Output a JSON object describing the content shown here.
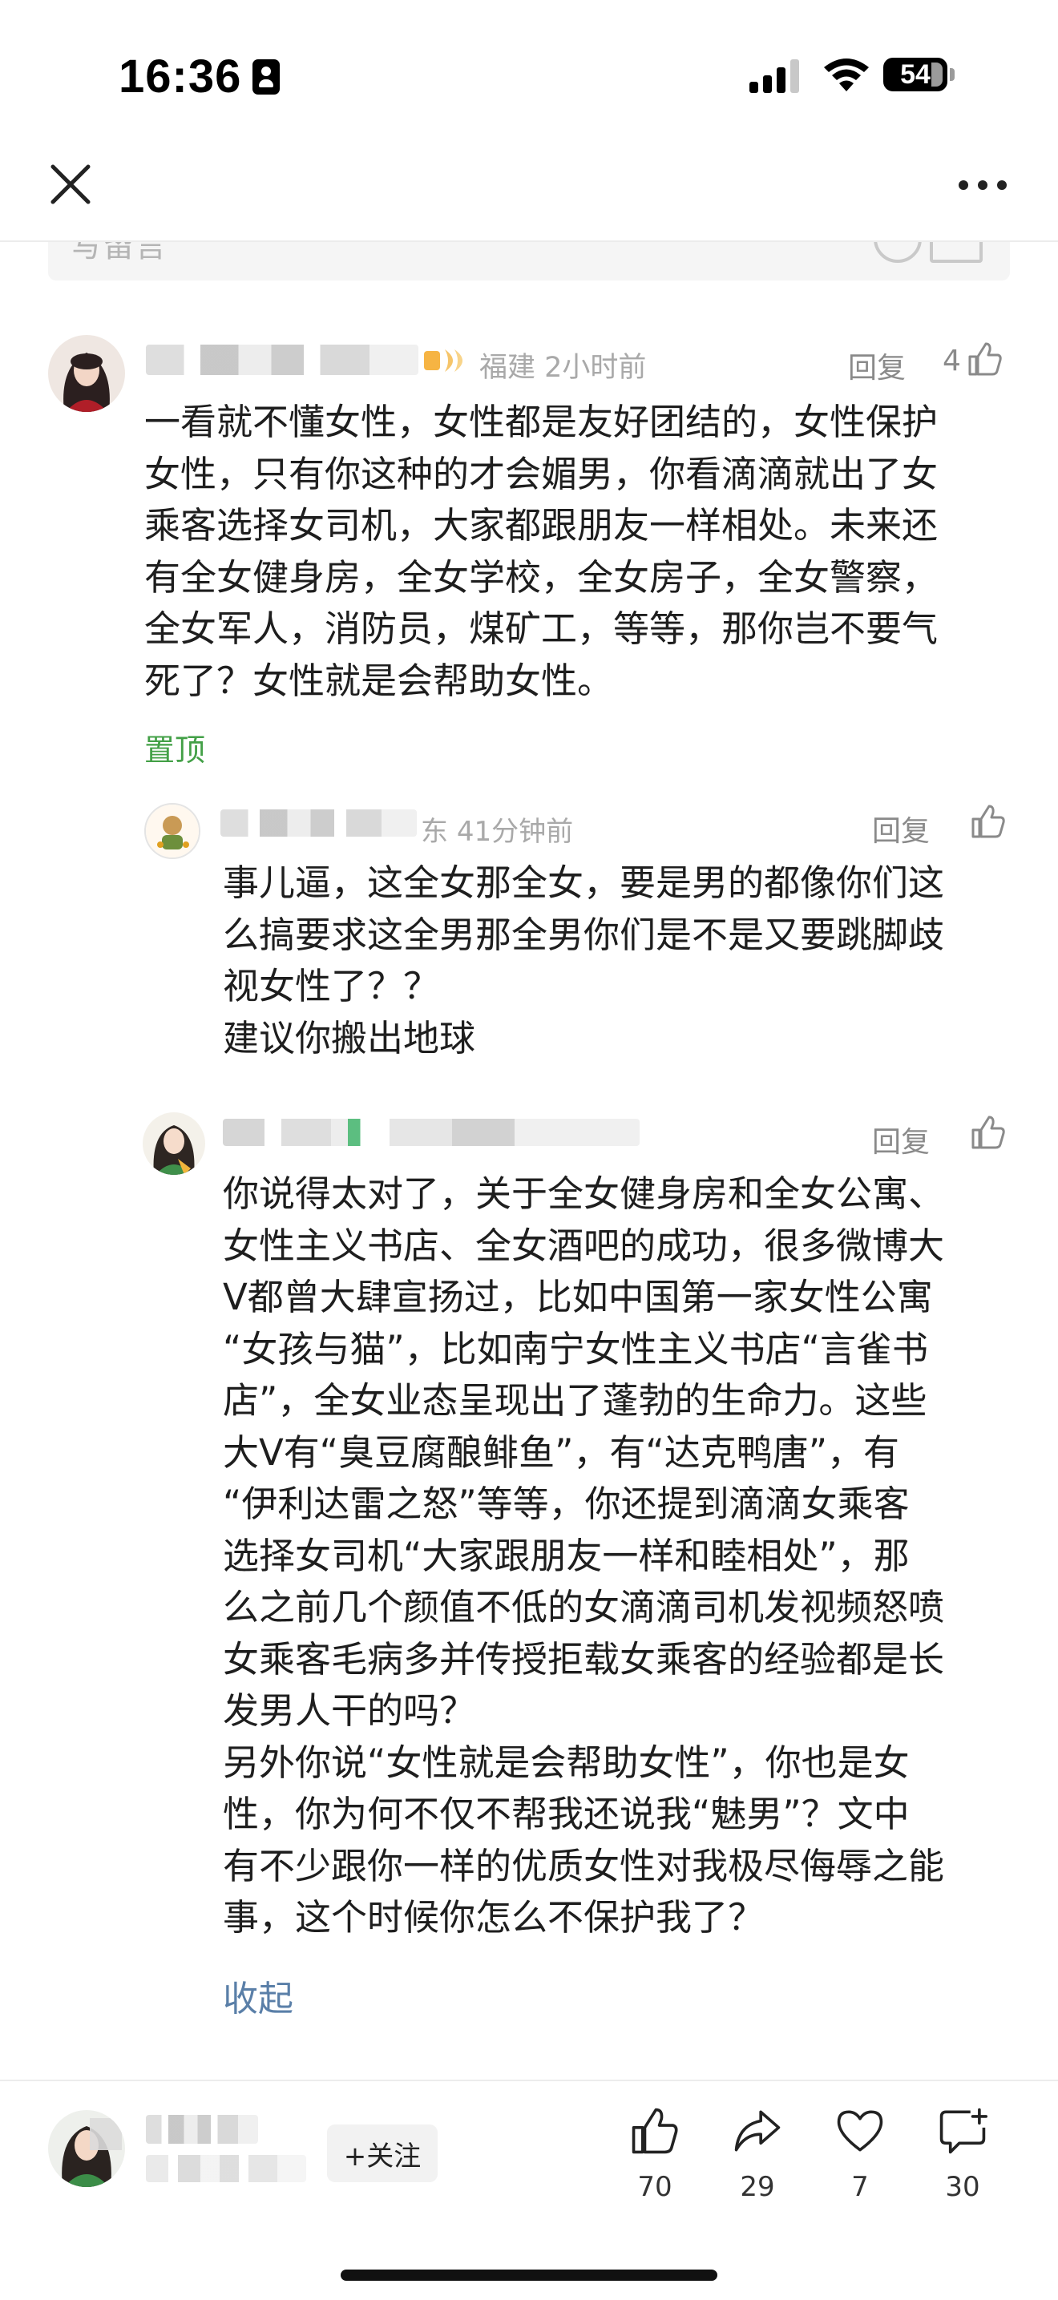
{
  "status_bar": {
    "time": "16:36",
    "battery": "54"
  },
  "input": {
    "placeholder": "写留言"
  },
  "comments": [
    {
      "location": "福建",
      "time": "2小时前",
      "reply_label": "回复",
      "likes": "4",
      "text": "一看就不懂女性，女性都是友好团结的，女性保护女性，只有你这种的才会媚男，你看滴滴就出了女乘客选择女司机，大家都跟朋友一样相处。未来还有全女健身房，全女学校，全女房子，全女警察，全女军人，消防员，煤矿工，等等，那你岂不要气死了？女性就是会帮助女性。",
      "lines": [
        "一看就不懂女性，女性都是友好团结的，女性保护",
        "女性，只有你这种的才会媚男，你看滴滴就出了女",
        "乘客选择女司机，大家都跟朋友一样相处。未来还",
        "有全女健身房，全女学校，全女房子，全女警察，",
        "全女军人，消防员，煤矿工，等等，那你岂不要气",
        "死了？女性就是会帮助女性。"
      ],
      "pin_label": "置顶"
    }
  ],
  "replies": [
    {
      "location_fragment": "东",
      "time": "41分钟前",
      "reply_label": "回复",
      "lines": [
        "事儿逼，这全女那全女，要是男的都像你们这",
        "么搞要求这全男那全男你们是不是又要跳脚歧",
        "视女性了？？",
        "建议你搬出地球"
      ]
    },
    {
      "reply_label": "回复",
      "lines": [
        "你说得太对了，关于全女健身房和全女公寓、",
        "女性主义书店、全女酒吧的成功，很多微博大",
        "V都曾大肆宣扬过，比如中国第一家女性公寓",
        "“女孩与猫”，比如南宁女性主义书店“言雀书",
        "店”，全女业态呈现出了蓬勃的生命力。这些",
        "大V有“臭豆腐酿鲱鱼”，有“达克鸭唐”，有",
        "“伊利达雷之怒”等等，你还提到滴滴女乘客",
        "选择女司机“大家跟朋友一样和睦相处”，那",
        "么之前几个颜值不低的女滴滴司机发视频怒喷",
        "女乘客毛病多并传授拒载女乘客的经验都是长",
        "发男人干的吗？",
        "另外你说“女性就是会帮助女性”，你也是女",
        "性，你为何不仅不帮我还说我“魅男”？文中",
        "有不少跟你一样的优质女性对我极尽侮辱之能",
        "事，这个时候你怎么不保护我了？"
      ],
      "collapse_label": "收起"
    }
  ],
  "bottom_bar": {
    "follow_label": "+关注",
    "likes": "70",
    "shares": "29",
    "favorites": "7",
    "comments": "30"
  }
}
